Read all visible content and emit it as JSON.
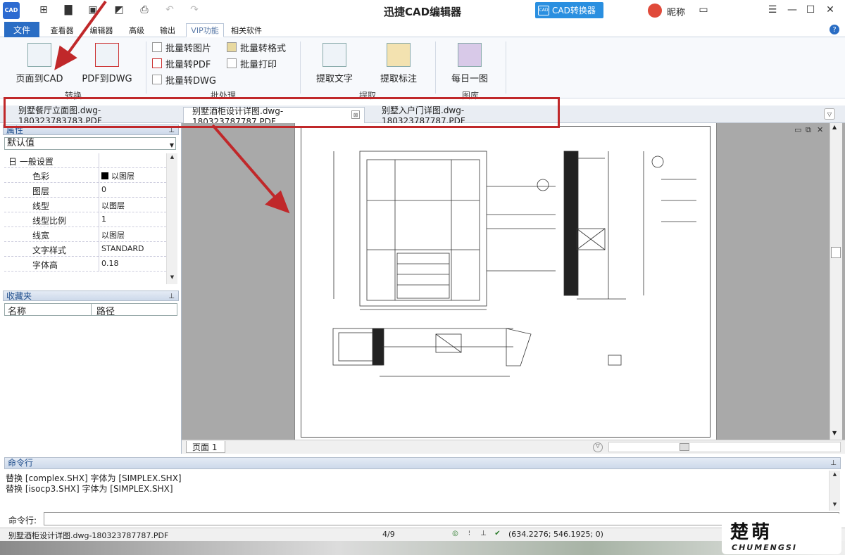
{
  "titlebar": {
    "logo": "CAD",
    "title": "迅捷CAD编辑器",
    "converter": "CAD转换器",
    "converter_icon": "CAD",
    "nickname": "昵称"
  },
  "menu": {
    "tabs": [
      "文件",
      "查看器",
      "编辑器",
      "高级",
      "输出",
      "VIP功能",
      "相关软件"
    ],
    "active": "VIP功能",
    "help": "?"
  },
  "ribbon": {
    "convert": {
      "label": "转换",
      "page_to_cad": "页面到CAD",
      "pdf_to_dwg": "PDF到DWG"
    },
    "batch": {
      "label": "批处理",
      "to_image": "批量转图片",
      "to_pdf": "批量转PDF",
      "to_dwg": "批量转DWG",
      "to_format": "批量转格式",
      "print": "批量打印"
    },
    "extract": {
      "label": "提取",
      "text": "提取文字",
      "annot": "提取标注"
    },
    "library": {
      "label": "图库",
      "daily": "每日一图"
    }
  },
  "doc_tabs": [
    {
      "label": "别墅餐厅立面图.dwg-180323783783.PDF"
    },
    {
      "label": "别墅酒柜设计详图.dwg-180323787787.PDF",
      "close": "⊠"
    },
    {
      "label": "别墅入户门详图.dwg-180323787787.PDF"
    }
  ],
  "properties": {
    "header": "属性",
    "combo": "默认值",
    "rows": [
      {
        "k": "日 一般设置",
        "v": ""
      },
      {
        "k": "色彩",
        "v": "以图层"
      },
      {
        "k": "图层",
        "v": "0"
      },
      {
        "k": "线型",
        "v": "以图层"
      },
      {
        "k": "线型比例",
        "v": "1"
      },
      {
        "k": "线宽",
        "v": "以图层"
      },
      {
        "k": "文字样式",
        "v": "STANDARD"
      },
      {
        "k": "字体高",
        "v": "0.18"
      }
    ]
  },
  "favorites": {
    "header": "收藏夹",
    "col_name": "名称",
    "col_path": "路径"
  },
  "canvas": {
    "page_tab": "页面 1"
  },
  "command": {
    "header": "命令行",
    "log": [
      "替换 [complex.SHX] 字体为 [SIMPLEX.SHX]",
      "替换 [isocp3.SHX] 字体为 [SIMPLEX.SHX]"
    ],
    "input_label": "命令行:"
  },
  "status": {
    "file": "别墅酒柜设计详图.dwg-180323787787.PDF",
    "page": "4/9",
    "coords": "(634.2276; 546.1925; 0)"
  },
  "watermark": {
    "logo": "楚萌",
    "text": "CHUMENGSI"
  },
  "colors": {
    "accent": "#2a6dc4",
    "annotation_red": "#c0282a",
    "converter": "#2a8fe0"
  }
}
